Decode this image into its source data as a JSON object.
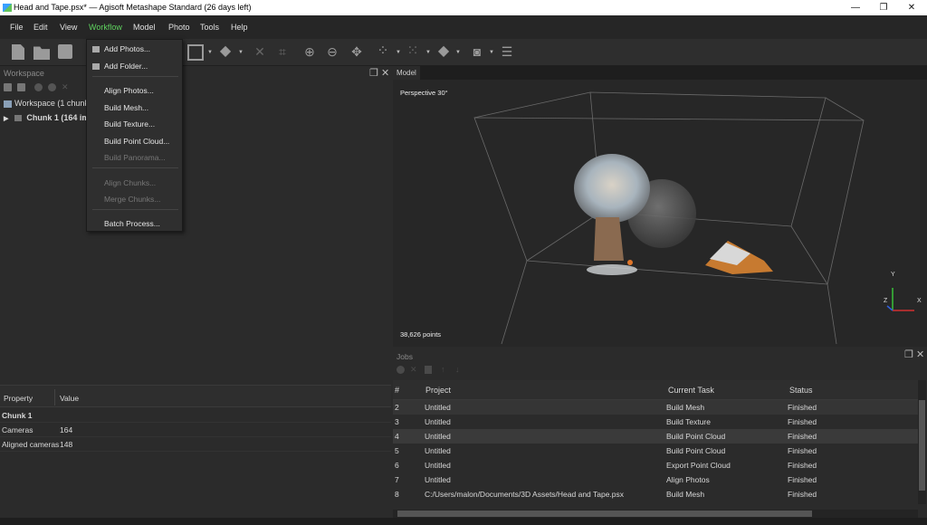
{
  "window": {
    "title": "Head and Tape.psx* — Agisoft Metashape Standard (26 days left)",
    "minimize": "—",
    "maximize": "❐",
    "close": "✕"
  },
  "menubar": {
    "items": [
      "File",
      "Edit",
      "View",
      "Workflow",
      "Model",
      "Photo",
      "Tools",
      "Help"
    ],
    "active": "Workflow"
  },
  "workflow_menu": {
    "items": [
      {
        "label": "Add Photos...",
        "enabled": true
      },
      {
        "label": "Add Folder...",
        "enabled": true
      },
      {
        "label": "Align Photos...",
        "enabled": true
      },
      {
        "label": "Build Mesh...",
        "enabled": true
      },
      {
        "label": "Build Texture...",
        "enabled": true
      },
      {
        "label": "Build Point Cloud...",
        "enabled": true
      },
      {
        "label": "Build Panorama...",
        "enabled": false
      },
      {
        "label": "Align Chunks...",
        "enabled": false
      },
      {
        "label": "Merge Chunks...",
        "enabled": false
      },
      {
        "label": "Batch Process...",
        "enabled": true
      }
    ]
  },
  "workspace": {
    "title": "Workspace",
    "tree": [
      {
        "label": "Workspace (1 chunks,"
      },
      {
        "label": "Chunk 1 (164 ima"
      }
    ]
  },
  "properties": {
    "headers": [
      "Property",
      "Value"
    ],
    "rows": [
      {
        "property": "Chunk 1",
        "value": ""
      },
      {
        "property": "Cameras",
        "value": "164"
      },
      {
        "property": "Aligned cameras",
        "value": "148"
      }
    ]
  },
  "model": {
    "tab": "Model",
    "view_label": "Perspective 30°",
    "points_label": "38,626 points",
    "axes": {
      "x": "X",
      "y": "Y",
      "z": "Z"
    }
  },
  "jobs": {
    "title": "Jobs",
    "headers": [
      "#",
      "Project",
      "Current Task",
      "Status"
    ],
    "rows": [
      {
        "num": "2",
        "project": "Untitled",
        "task": "Build Mesh",
        "status": "Finished"
      },
      {
        "num": "3",
        "project": "Untitled",
        "task": "Build Texture",
        "status": "Finished"
      },
      {
        "num": "4",
        "project": "Untitled",
        "task": "Build Point Cloud",
        "status": "Finished"
      },
      {
        "num": "5",
        "project": "Untitled",
        "task": "Build Point Cloud",
        "status": "Finished"
      },
      {
        "num": "6",
        "project": "Untitled",
        "task": "Export Point Cloud",
        "status": "Finished"
      },
      {
        "num": "7",
        "project": "Untitled",
        "task": "Align Photos",
        "status": "Finished"
      },
      {
        "num": "8",
        "project": "C:/Users/malon/Documents/3D Assets/Head and Tape.psx",
        "task": "Build Mesh",
        "status": "Finished"
      }
    ]
  }
}
